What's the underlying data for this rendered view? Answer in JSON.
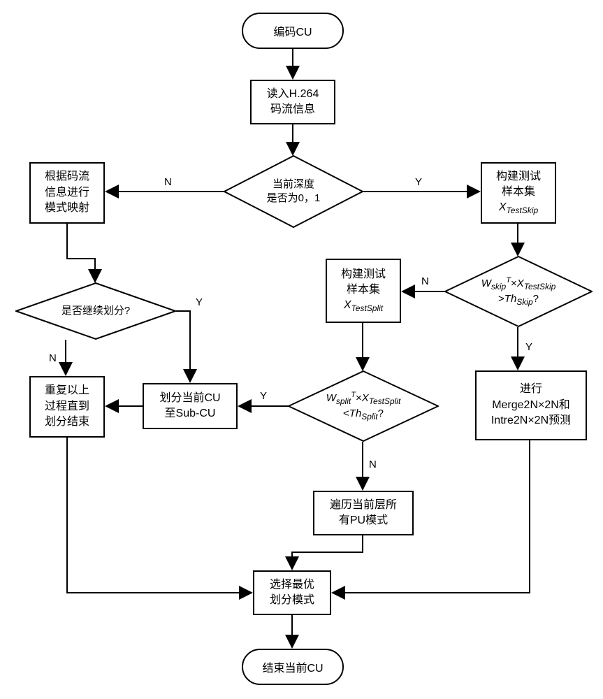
{
  "n": {
    "start": "编码CU",
    "end": "结束当前CU",
    "readH264_l1": "读入H.264",
    "readH264_l2": "码流信息",
    "depthCheck_l1": "当前深度",
    "depthCheck_l2": "是否为0，1",
    "mapping_l1": "根据码流",
    "mapping_l2": "信息进行",
    "mapping_l3": "模式映射",
    "buildSkip_l1": "构建测试",
    "buildSkip_l2": "样本集",
    "buildSplit_l1": "构建测试",
    "buildSplit_l2": "样本集",
    "continueSplit": "是否继续划分?",
    "repeat_l1": "重复以上",
    "repeat_l2": "过程直到",
    "repeat_l3": "划分结束",
    "splitCU_l1": "划分当前CU",
    "splitCU_l2": "至Sub-CU",
    "mergeIntra_l1": "进行",
    "mergeIntra_l2": "Merge2N×2N和",
    "mergeIntra_l3": "Intre2N×2N预测",
    "traverse_l1": "遍历当前层所",
    "traverse_l2": "有PU模式",
    "selectBest_l1": "选择最优",
    "selectBest_l2": "划分模式"
  },
  "math": {
    "xTestSkip": "X",
    "xTestSkipSub": "TestSkip",
    "xTestSplit": "X",
    "xTestSplitSub": "TestSplit",
    "w": "W",
    "wSkipSub": "skip",
    "wSplitSub": "split",
    "T": "T",
    "thSkip": "Th",
    "thSkipSub": "Skip",
    "thSplit": "Th",
    "thSplitSub": "Split",
    "times": "×",
    "gt": ">",
    "lt": "<",
    "q": "?"
  },
  "edge": {
    "Y": "Y",
    "N": "N"
  },
  "chart_data": {
    "type": "diagram-flowchart",
    "nodes": [
      {
        "id": "start",
        "type": "terminal",
        "label": "编码CU"
      },
      {
        "id": "read",
        "type": "process",
        "label": "读入H.264 码流信息"
      },
      {
        "id": "d_depth",
        "type": "decision",
        "label": "当前深度是否为0,1"
      },
      {
        "id": "mapping",
        "type": "process",
        "label": "根据码流信息进行模式映射"
      },
      {
        "id": "buildSkip",
        "type": "process",
        "label": "构建测试样本集 X_TestSkip"
      },
      {
        "id": "d_skip",
        "type": "decision",
        "label": "W_skip^T × X_TestSkip > Th_Skip ?"
      },
      {
        "id": "mergeIntra",
        "type": "process",
        "label": "进行 Merge2N×2N 和 Intre2N×2N 预测"
      },
      {
        "id": "buildSplit",
        "type": "process",
        "label": "构建测试样本集 X_TestSplit"
      },
      {
        "id": "d_split",
        "type": "decision",
        "label": "W_split^T × X_TestSplit < Th_Split ?"
      },
      {
        "id": "splitCU",
        "type": "process",
        "label": "划分当前CU至Sub-CU"
      },
      {
        "id": "traverse",
        "type": "process",
        "label": "遍历当前层所有PU模式"
      },
      {
        "id": "d_continue",
        "type": "decision",
        "label": "是否继续划分?"
      },
      {
        "id": "repeat",
        "type": "process",
        "label": "重复以上过程直到划分结束"
      },
      {
        "id": "select",
        "type": "process",
        "label": "选择最优划分模式"
      },
      {
        "id": "end",
        "type": "terminal",
        "label": "结束当前CU"
      }
    ],
    "edges": [
      {
        "from": "start",
        "to": "read"
      },
      {
        "from": "read",
        "to": "d_depth"
      },
      {
        "from": "d_depth",
        "to": "mapping",
        "label": "N"
      },
      {
        "from": "d_depth",
        "to": "buildSkip",
        "label": "Y"
      },
      {
        "from": "mapping",
        "to": "d_continue"
      },
      {
        "from": "buildSkip",
        "to": "d_skip"
      },
      {
        "from": "d_skip",
        "to": "mergeIntra",
        "label": "Y"
      },
      {
        "from": "d_skip",
        "to": "buildSplit",
        "label": "N"
      },
      {
        "from": "buildSplit",
        "to": "d_split"
      },
      {
        "from": "d_split",
        "to": "splitCU",
        "label": "Y"
      },
      {
        "from": "d_split",
        "to": "traverse",
        "label": "N"
      },
      {
        "from": "d_continue",
        "to": "splitCU",
        "label": "Y"
      },
      {
        "from": "d_continue",
        "to": "repeat",
        "label": "N"
      },
      {
        "from": "splitCU",
        "to": "repeat"
      },
      {
        "from": "mergeIntra",
        "to": "select"
      },
      {
        "from": "traverse",
        "to": "select"
      },
      {
        "from": "repeat",
        "to": "select"
      },
      {
        "from": "select",
        "to": "end"
      }
    ]
  }
}
